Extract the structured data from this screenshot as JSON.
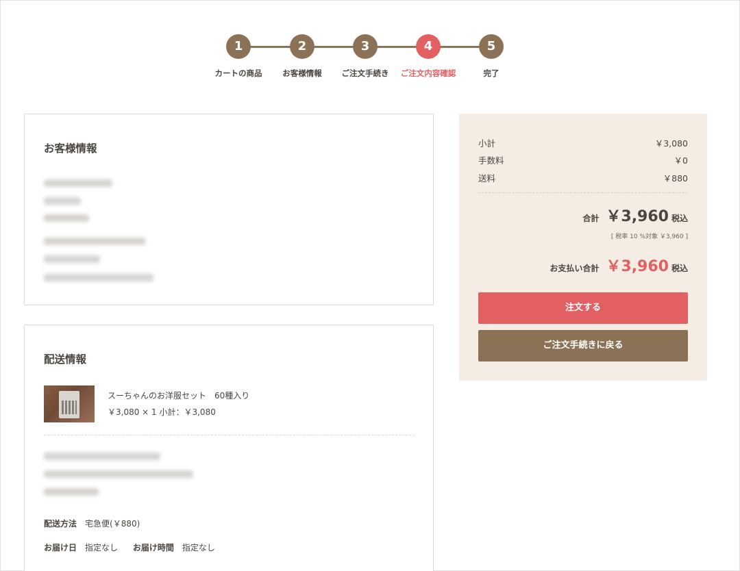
{
  "steps": [
    {
      "num": "1",
      "label": "カートの商品"
    },
    {
      "num": "2",
      "label": "お客様情報"
    },
    {
      "num": "3",
      "label": "ご注文手続き"
    },
    {
      "num": "4",
      "label": "ご注文内容確認",
      "active": true
    },
    {
      "num": "5",
      "label": "完了"
    }
  ],
  "customer": {
    "title": "お客様情報"
  },
  "shipping": {
    "title": "配送情報",
    "product_name": "スーちゃんのお洋服セット　60種入り",
    "product_price": "￥3,080 × 1 小計：￥3,080",
    "method_label": "配送方法",
    "method_value": "宅急便(￥880)",
    "date_label": "お届け日",
    "date_value": "指定なし",
    "time_label": "お届け時間",
    "time_value": "指定なし"
  },
  "summary": {
    "subtotal_label": "小計",
    "subtotal_value": "￥3,080",
    "fee_label": "手数料",
    "fee_value": "￥0",
    "shipping_label": "送料",
    "shipping_value": "￥880",
    "total_label": "合計",
    "total_value": "￥3,960",
    "tax_included": "税込",
    "tax_note": "[ 税率 10 %対象 ￥3,960 ]",
    "payment_label": "お支払い合計",
    "payment_value": "￥3,960",
    "payment_tax_included": "税込"
  },
  "buttons": {
    "order": "注文する",
    "back": "ご注文手続きに戻る"
  },
  "colors": {
    "brown": "#8b7156",
    "accent_red": "#e36062",
    "summary_bg": "#f5ece4"
  }
}
